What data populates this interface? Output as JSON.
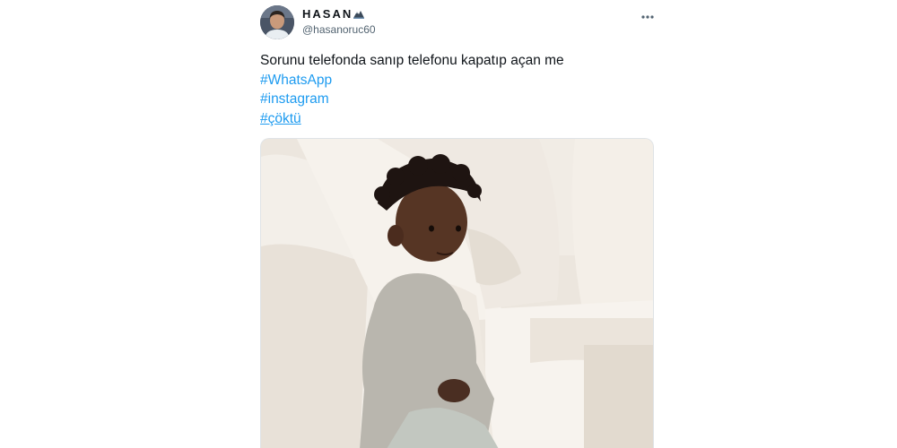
{
  "tweet": {
    "author": {
      "display_name": "HASAN",
      "name_emoji": "mountain-icon",
      "handle": "@hasanoruc60",
      "avatar": "avatar"
    },
    "more_icon": "more-options-icon",
    "text": "Sorunu telefonda sanıp telefonu kapatıp açan me",
    "hashtags": [
      "#WhatsApp",
      "#instagram",
      "#çöktü"
    ],
    "media": {
      "kind": "photo",
      "subject": "baby-sitting-on-sofa"
    }
  },
  "colors": {
    "link": "#1d9bf0",
    "text": "#0f1419",
    "secondary_text": "#536471",
    "background": "#ffffff"
  }
}
